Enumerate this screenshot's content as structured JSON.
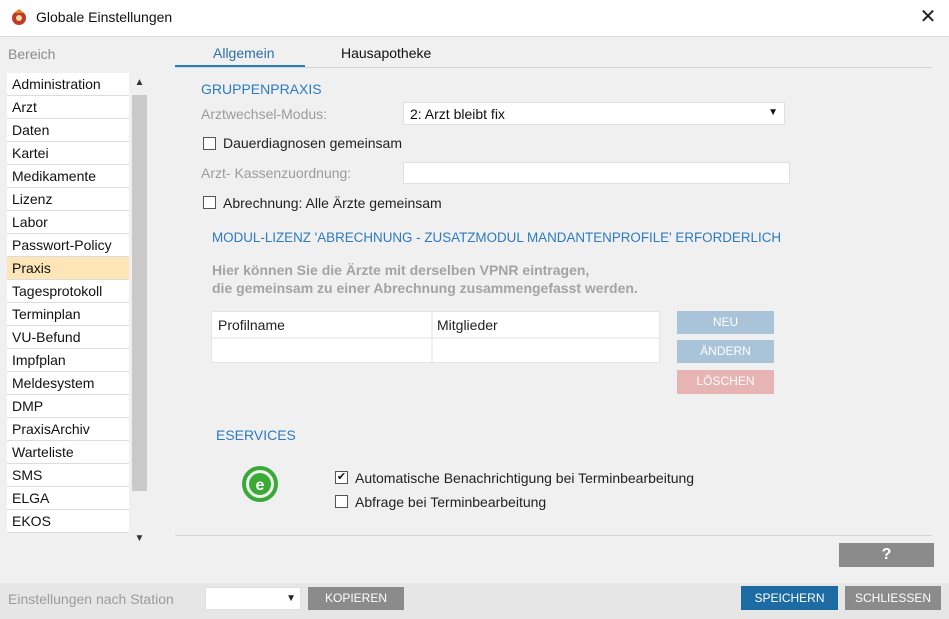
{
  "window": {
    "title": "Globale Einstellungen",
    "close_symbol": "✕"
  },
  "sidebar": {
    "header": "Bereich",
    "items": [
      {
        "label": "Administration"
      },
      {
        "label": "Arzt"
      },
      {
        "label": "Daten"
      },
      {
        "label": "Kartei"
      },
      {
        "label": "Medikamente"
      },
      {
        "label": "Lizenz"
      },
      {
        "label": "Labor"
      },
      {
        "label": "Passwort-Policy"
      },
      {
        "label": "Praxis",
        "selected": true
      },
      {
        "label": "Tagesprotokoll"
      },
      {
        "label": "Terminplan"
      },
      {
        "label": "VU-Befund"
      },
      {
        "label": "Impfplan"
      },
      {
        "label": "Meldesystem"
      },
      {
        "label": "DMP"
      },
      {
        "label": "PraxisArchiv"
      },
      {
        "label": "Warteliste"
      },
      {
        "label": "SMS"
      },
      {
        "label": "ELGA"
      },
      {
        "label": "EKOS"
      }
    ]
  },
  "tabs": [
    {
      "label": "Allgemein",
      "active": true
    },
    {
      "label": "Hausapotheke",
      "active": false
    }
  ],
  "gruppenpraxis": {
    "section_title": "GRUPPENPRAXIS",
    "arztwechsel_label": "Arztwechsel-Modus:",
    "arztwechsel_value": "2: Arzt bleibt fix",
    "dauerdiagnosen_label": "Dauerdiagnosen gemeinsam",
    "dauerdiagnosen_checked": false,
    "kassen_label": "Arzt- Kassenzuordnung:",
    "kassen_value": "",
    "abrechnung_label": "Abrechnung: Alle Ärzte gemeinsam",
    "abrechnung_checked": false
  },
  "modul_lizenz": {
    "notice": "MODUL-LIZENZ 'ABRECHNUNG - ZUSATZMODUL MANDANTENPROFILE' ERFORDERLICH",
    "hint_line1": "Hier können Sie die Ärzte mit derselben VPNR eintragen,",
    "hint_line2": "die gemeinsam zu einer Abrechnung zusammengefasst werden.",
    "table_headers": [
      "Profilname",
      "Mitglieder"
    ],
    "buttons": {
      "neu": "NEU",
      "aendern": "ÄNDERN",
      "loeschen": "LÖSCHEN"
    }
  },
  "eservices": {
    "section_title": "ESERVICES",
    "auto_notify_label": "Automatische Benachrichtigung bei Terminbearbeitung",
    "auto_notify_checked": true,
    "query_label": "Abfrage bei Terminbearbeitung",
    "query_checked": false
  },
  "help_button": "?",
  "bottom": {
    "station_label": "Einstellungen nach Station",
    "station_value": "",
    "kopieren": "KOPIEREN",
    "speichern": "SPEICHERN",
    "schliessen": "SCHLIESSEN"
  },
  "colors": {
    "accent": "#2c7bbf",
    "selected_item": "#fde5b8",
    "primary_button": "#1d6ba3",
    "disabled_blue": "#a9c3d8",
    "disabled_red": "#e7b4b4",
    "gray_button": "#8b8b8b",
    "eservices_logo": "#3aa935"
  }
}
